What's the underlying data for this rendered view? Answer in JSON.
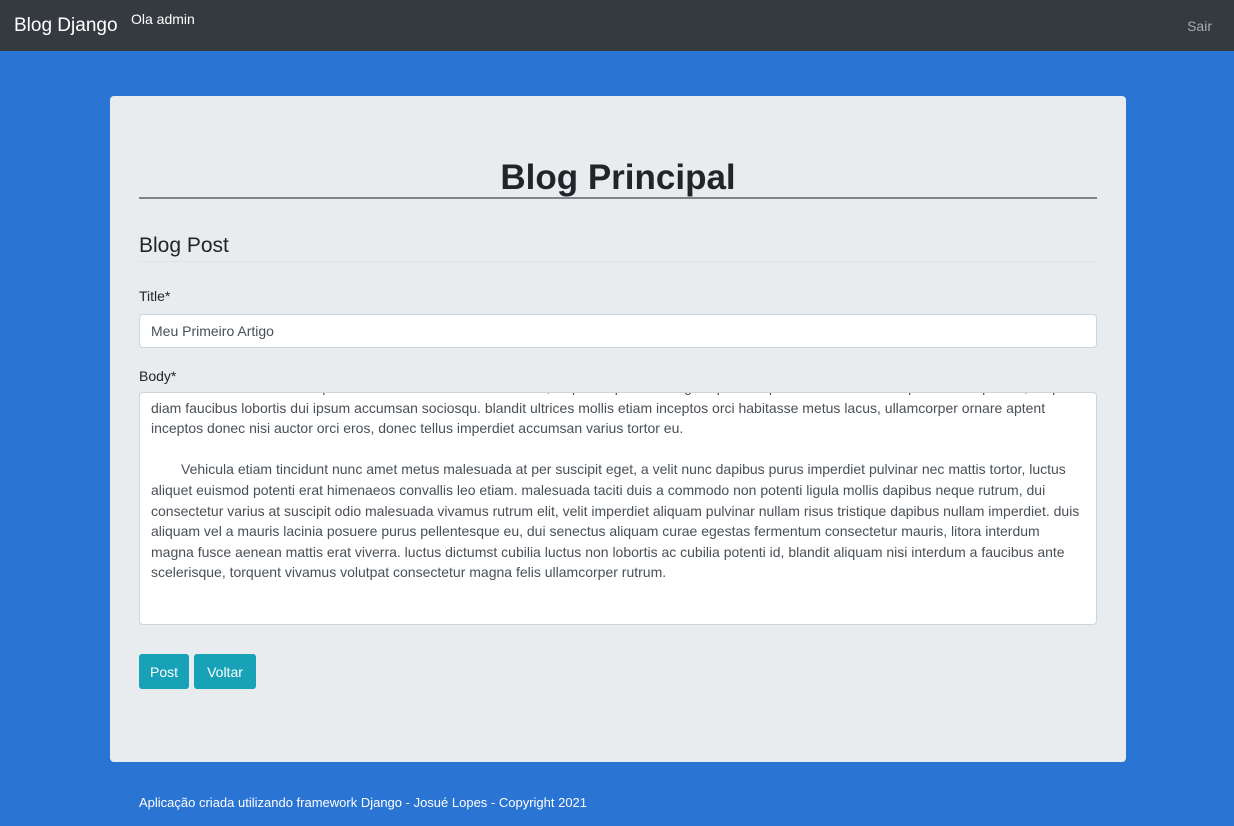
{
  "navbar": {
    "brand": "Blog Django",
    "greeting": "Ola admin",
    "logout": "Sair"
  },
  "page": {
    "title": "Blog Principal",
    "section_title": "Blog Post"
  },
  "form": {
    "title_label": "Title*",
    "title_value": "Meu Primeiro Artigo",
    "body_label": "Body*",
    "body_paragraphs": [
      "...... libero senectus odio dapibus condimentum iaculis ac varius, vulputate posuere sagittis porta turpis ultrices fusce suscipit vivamus potenti, neque diam faucibus lobortis dui ipsum accumsan sociosqu. blandit ultrices mollis etiam inceptos orci habitasse metus lacus, ullamcorper ornare aptent inceptos donec nisi auctor orci eros, donec tellus imperdiet accumsan varius tortor eu.",
      "Vehicula etiam tincidunt nunc amet metus malesuada at per suscipit eget, a velit nunc dapibus purus imperdiet pulvinar nec mattis tortor, luctus aliquet euismod potenti erat himenaeos convallis leo etiam. malesuada taciti duis a commodo non potenti ligula mollis dapibus neque rutrum, dui consectetur varius at suscipit odio malesuada vivamus rutrum elit, velit imperdiet aliquam pulvinar nullam risus tristique dapibus nullam imperdiet. duis aliquam vel a mauris lacinia posuere purus pellentesque eu, dui senectus aliquam curae egestas fermentum consectetur mauris, litora interdum magna fusce aenean mattis erat viverra. luctus dictumst cubilia luctus non lobortis ac cubilia potenti id, blandit aliquam nisi interdum a faucibus ante scelerisque, torquent vivamus volutpat consectetur magna felis ullamcorper rutrum."
    ],
    "post_button": "Post",
    "back_button": "Voltar"
  },
  "footer": {
    "text": "Aplicação criada utilizando framework Django - Josué Lopes - Copyright 2021"
  }
}
